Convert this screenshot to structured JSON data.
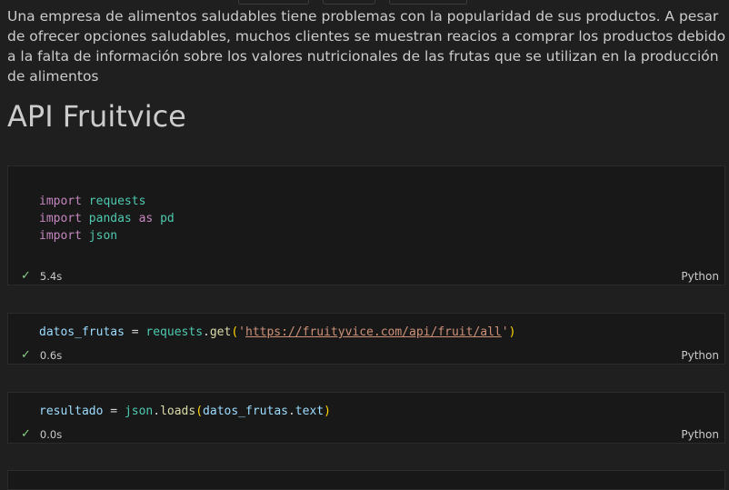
{
  "markdown": {
    "paragraph": "Una empresa de alimentos saludables tiene problemas con la popularidad de sus productos. A pesar de ofrecer opciones saludables, muchos clientes se muestran reacios a comprar los productos debido a la falta de información sobre los valores nutricionales de las frutas que se utilizan en la producción de alimentos",
    "heading": "API Fruitvice"
  },
  "cells": [
    {
      "lines": [
        {
          "kw": "import",
          "mod": "requests"
        },
        {
          "kw": "import",
          "mod": "pandas",
          "kw2": "as",
          "alias": "pd"
        },
        {
          "kw": "import",
          "mod": "json"
        }
      ],
      "time": "5.4s",
      "language": "Python"
    },
    {
      "var": "datos_frutas",
      "op": " = ",
      "obj": "requests",
      "dot": ".",
      "fn": "get",
      "open": "(",
      "quote_open": "'",
      "url": "https://fruityvice.com/api/fruit/all",
      "quote_close": "'",
      "close": ")",
      "time": "0.6s",
      "language": "Python"
    },
    {
      "var": "resultado",
      "op": " = ",
      "obj": "json",
      "dot": ".",
      "fn": "loads",
      "open": "(",
      "arg": "datos_frutas",
      "dot2": ".",
      "attr": "text",
      "close": ")",
      "time": "0.0s",
      "language": "Python"
    }
  ],
  "icons": {
    "status_ok": "check-icon"
  }
}
